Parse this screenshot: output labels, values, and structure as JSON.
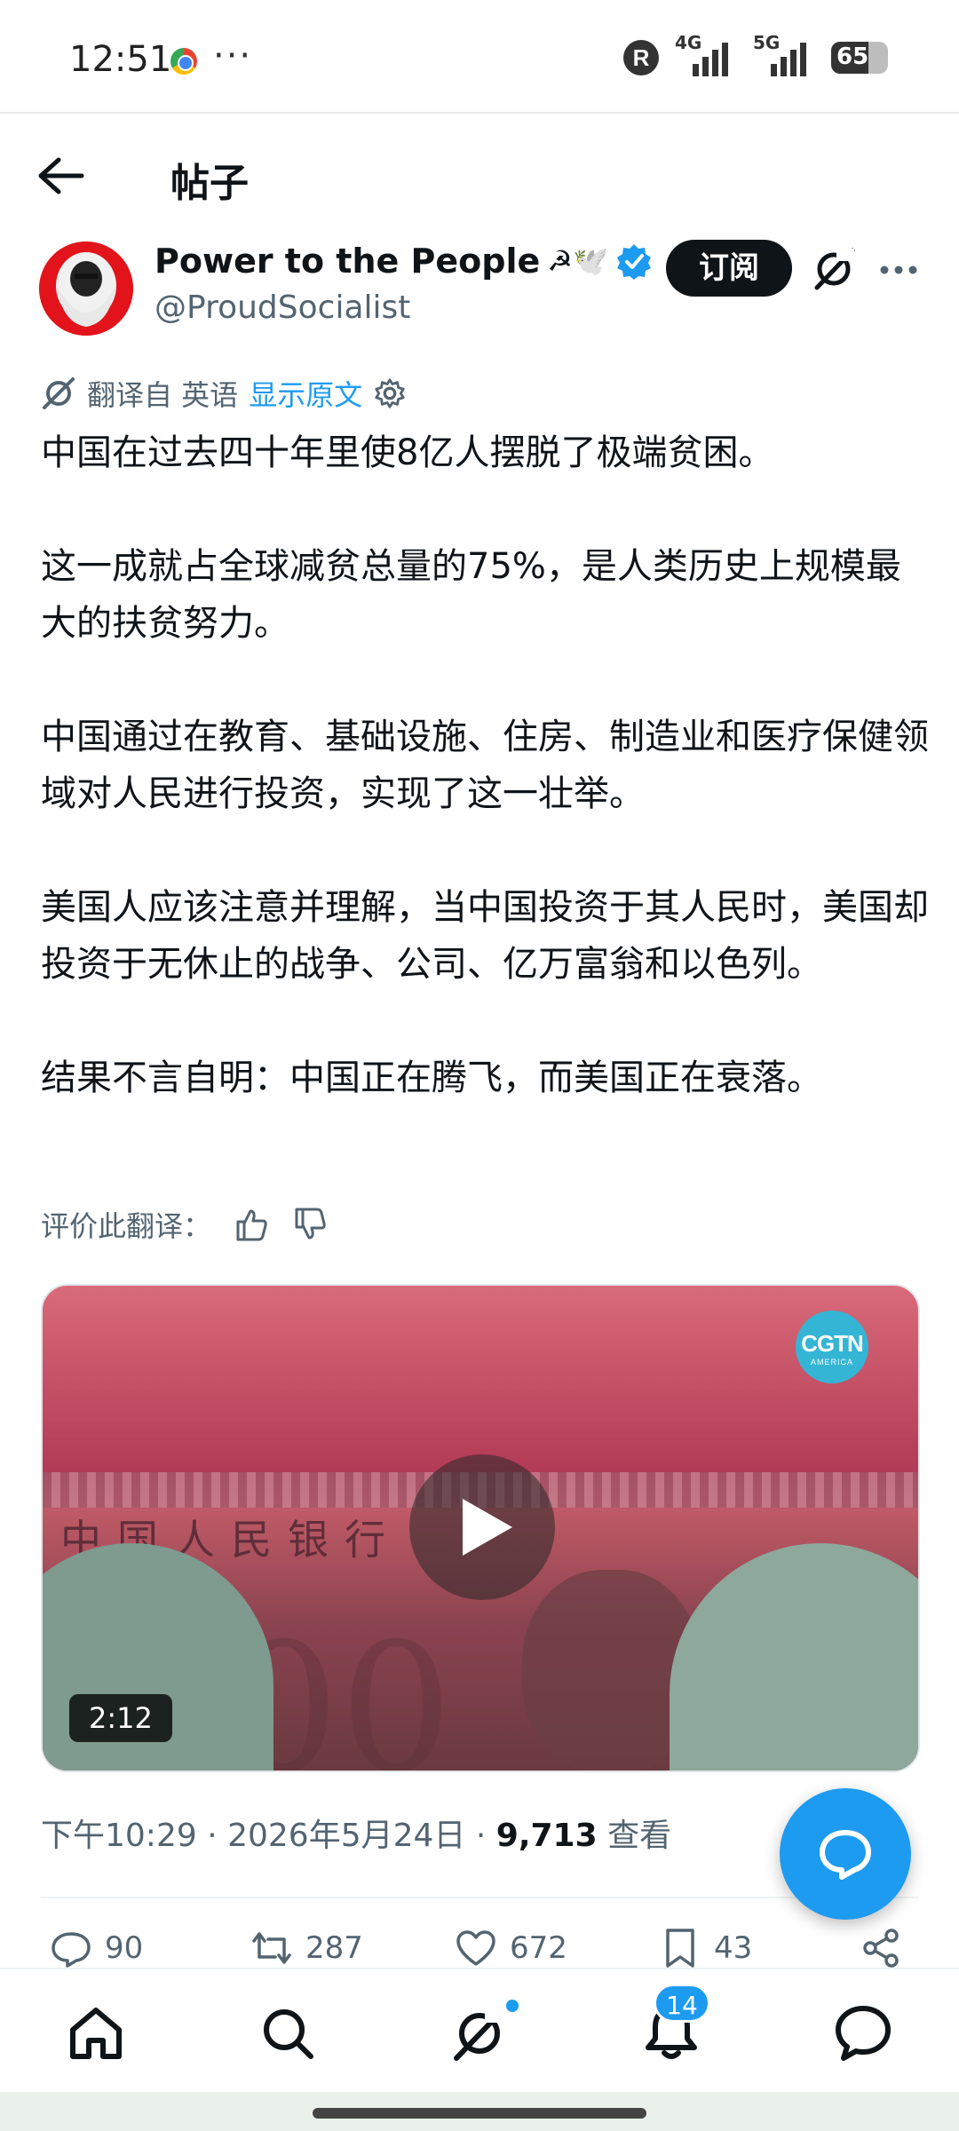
{
  "status_bar": {
    "time": "12:51",
    "dots": "···",
    "r_badge": "R",
    "net1": "4G",
    "net2": "5G",
    "battery": "65"
  },
  "header": {
    "title": "帖子"
  },
  "author": {
    "name": "Power to the People",
    "emoji": "☭🕊️",
    "handle": "@ProudSocialist",
    "subscribe_label": "订阅"
  },
  "translation": {
    "from_label": "翻译自 英语",
    "show_original": "显示原文"
  },
  "post": {
    "paragraphs": [
      "中国在过去四十年里使8亿人摆脱了极端贫困。",
      "这一成就占全球减贫总量的75%，是人类历史上规模最大的扶贫努力。",
      "中国通过在教育、基础设施、住房、制造业和医疗保健领域对人民进行投资，实现了这一壮举。",
      "美国人应该注意并理解，当中国投资于其人民时，美国却投资于无休止的战争、公司、亿万富翁和以色列。",
      "结果不言自明：中国正在腾飞，而美国正在衰落。"
    ],
    "rate_label": "评价此翻译："
  },
  "video": {
    "channel_logo": "CGTN",
    "channel_sub": "AMERICA",
    "banknote_text": "中国人民银行",
    "banknote_digits": "100",
    "duration": "2:12"
  },
  "meta": {
    "time": "下午10:29",
    "date": "2026年5月24日",
    "views_count": "9,713",
    "views_label": "查看"
  },
  "actions": {
    "replies": "90",
    "reposts": "287",
    "likes": "672",
    "bookmarks": "43"
  },
  "nav": {
    "notifications_badge": "14"
  },
  "colors": {
    "accent": "#1d9bf0",
    "text": "#0f1419",
    "muted": "#536471"
  }
}
